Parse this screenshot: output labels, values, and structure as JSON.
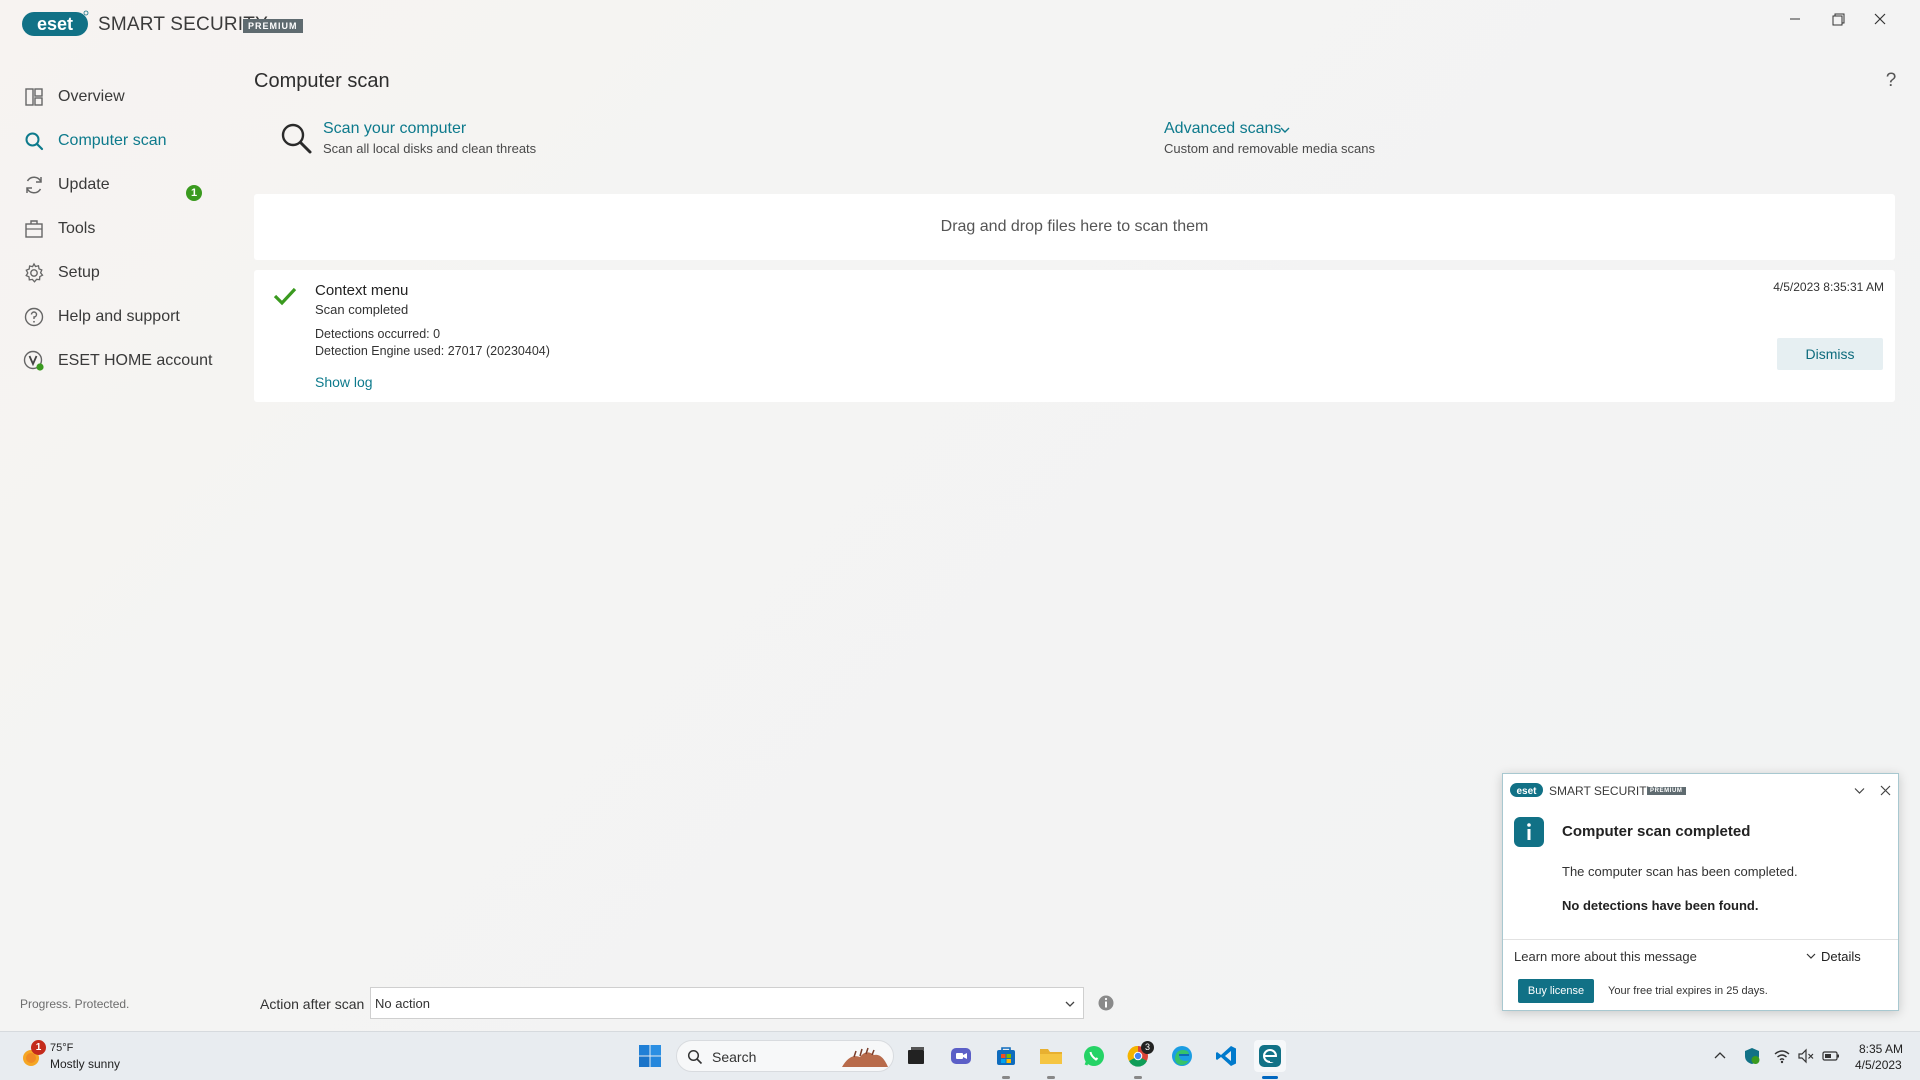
{
  "app": {
    "logo_text": "eset",
    "brand": "SMART SECURITY",
    "badge": "PREMIUM",
    "tagline": "Progress. Protected."
  },
  "window_controls": {
    "minimize": "minimize",
    "maximize": "restore",
    "close": "close"
  },
  "sidebar": {
    "items": [
      {
        "label": "Overview",
        "icon": "overview-icon"
      },
      {
        "label": "Computer scan",
        "icon": "search-icon",
        "active": true,
        "badge": "1"
      },
      {
        "label": "Update",
        "icon": "refresh-icon"
      },
      {
        "label": "Tools",
        "icon": "briefcase-icon"
      },
      {
        "label": "Setup",
        "icon": "gear-icon"
      },
      {
        "label": "Help and support",
        "icon": "help-icon"
      },
      {
        "label": "ESET HOME account",
        "icon": "account-icon"
      }
    ]
  },
  "main": {
    "title": "Computer scan",
    "help": "?",
    "scan_computer": {
      "title": "Scan your computer",
      "subtitle": "Scan all local disks and clean threats"
    },
    "advanced_scans": {
      "title": "Advanced scans",
      "subtitle": "Custom and removable media scans"
    },
    "dropzone": "Drag and drop files here to scan them",
    "result": {
      "title": "Context menu",
      "status": "Scan completed",
      "detections": "Detections occurred: 0",
      "engine": "Detection Engine used: 27017 (20230404)",
      "show_log": "Show log",
      "timestamp": "4/5/2023 8:35:31 AM",
      "dismiss": "Dismiss"
    },
    "action_after_scan": {
      "label": "Action after scan",
      "value": "No action"
    }
  },
  "toast": {
    "brand": "SMART SECURITY",
    "badge": "PREMIUM",
    "title": "Computer scan completed",
    "message": "The computer scan has been completed.",
    "detail": "No detections have been found.",
    "learn_more": "Learn more about this message",
    "details": "Details",
    "buy": "Buy license",
    "trial": "Your free trial expires in 25 days."
  },
  "taskbar": {
    "weather": {
      "temp": "75°F",
      "desc": "Mostly sunny",
      "badge": "1"
    },
    "search_placeholder": "Search",
    "clock": {
      "time": "8:35 AM",
      "date": "4/5/2023"
    },
    "chrome_badge": "3"
  },
  "colors": {
    "accent": "#0d7a8c",
    "success": "#3a9a1f",
    "eset_teal": "#117186"
  }
}
